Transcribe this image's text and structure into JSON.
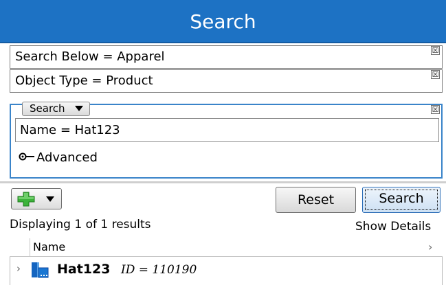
{
  "header": {
    "title": "Search"
  },
  "criteria": [
    {
      "label": "Search Below = Apparel"
    },
    {
      "label": "Object Type = Product"
    }
  ],
  "remove_glyph": "☒",
  "group": {
    "dropdown_label": "Search",
    "name_field_value": "Name = Hat123",
    "advanced_label": "Advanced"
  },
  "toolbar": {
    "add_icon": "green-plus-icon",
    "reset_label": "Reset",
    "search_label": "Search"
  },
  "results": {
    "count_text": "Displaying 1 of 1 results",
    "show_details_label": "Show Details",
    "columns": [
      {
        "label": "Name"
      }
    ],
    "rows": [
      {
        "name": "Hat123",
        "id_text": "ID = 110190"
      }
    ]
  },
  "colors": {
    "header_blue": "#1d72c4",
    "group_border": "#3a84c9",
    "plus_green": "#3cb33a"
  }
}
